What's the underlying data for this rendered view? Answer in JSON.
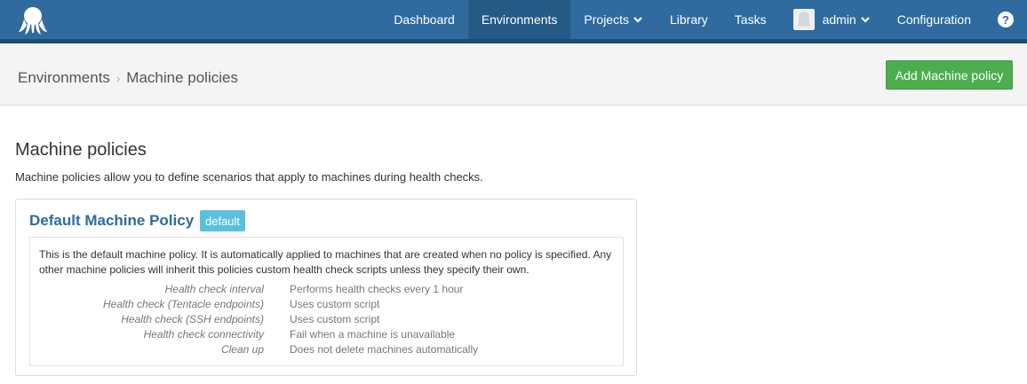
{
  "nav": {
    "items": [
      {
        "label": "Dashboard",
        "active": false,
        "dropdown": false
      },
      {
        "label": "Environments",
        "active": true,
        "dropdown": false
      },
      {
        "label": "Projects",
        "active": false,
        "dropdown": true
      },
      {
        "label": "Library",
        "active": false,
        "dropdown": false
      },
      {
        "label": "Tasks",
        "active": false,
        "dropdown": false
      }
    ],
    "user_label": "admin",
    "configuration_label": "Configuration",
    "help_glyph": "?",
    "colors": {
      "bar": "#2f6b9e",
      "active": "#245a86"
    }
  },
  "breadcrumb": {
    "parent": "Environments",
    "separator": "›",
    "current": "Machine policies"
  },
  "add_button_label": "Add Machine policy",
  "page": {
    "title": "Machine policies",
    "description": "Machine policies allow you to define scenarios that apply to machines during health checks."
  },
  "policy": {
    "name": "Default Machine Policy",
    "badge": "default",
    "description": "This is the default machine policy. It is automatically applied to machines that are created when no policy is specified. Any other machine policies will inherit this policies custom health check scripts unless they specify their own.",
    "details": [
      {
        "label": "Health check interval",
        "value": "Performs health checks every 1 hour"
      },
      {
        "label": "Health check (Tentacle endpoints)",
        "value": "Uses custom script"
      },
      {
        "label": "Health check (SSH endpoints)",
        "value": "Uses custom script"
      },
      {
        "label": "Health check connectivity",
        "value": "Fail when a machine is unavailable"
      },
      {
        "label": "Clean up",
        "value": "Does not delete machines automatically"
      }
    ]
  }
}
